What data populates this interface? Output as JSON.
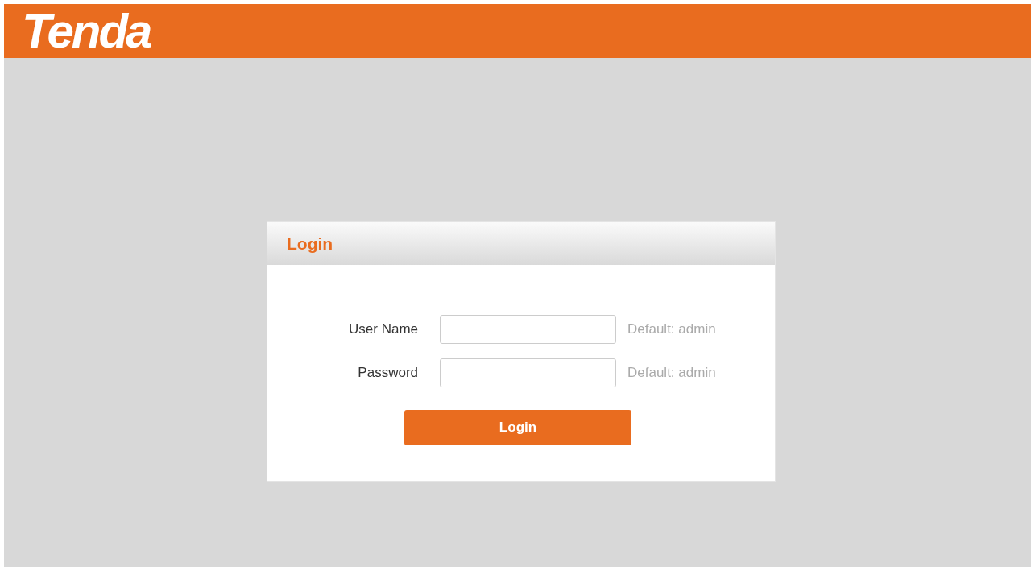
{
  "header": {
    "logo": "Tenda"
  },
  "login_panel": {
    "title": "Login",
    "fields": [
      {
        "label": "User Name",
        "hint": "Default: admin"
      },
      {
        "label": "Password",
        "hint": "Default: admin"
      }
    ],
    "button": "Login"
  }
}
